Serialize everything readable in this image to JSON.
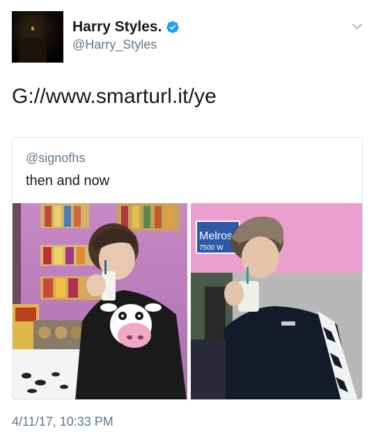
{
  "user": {
    "display_name": "Harry Styles.",
    "handle": "@Harry_Styles"
  },
  "tweet": {
    "text": "G://www.smarturl.it/ye",
    "date": "4/11/17, 10:33 PM"
  },
  "quoted": {
    "handle": "@signofhs",
    "text": "then and now",
    "image2_sign": "Melrose",
    "image2_sign_sub": "7500 W"
  },
  "colors": {
    "verified": "#1da1f2",
    "secondary_text": "#657786",
    "border": "#e1e8ed"
  },
  "icons": {
    "verified": "verified-badge-icon",
    "menu": "chevron-down-icon"
  }
}
